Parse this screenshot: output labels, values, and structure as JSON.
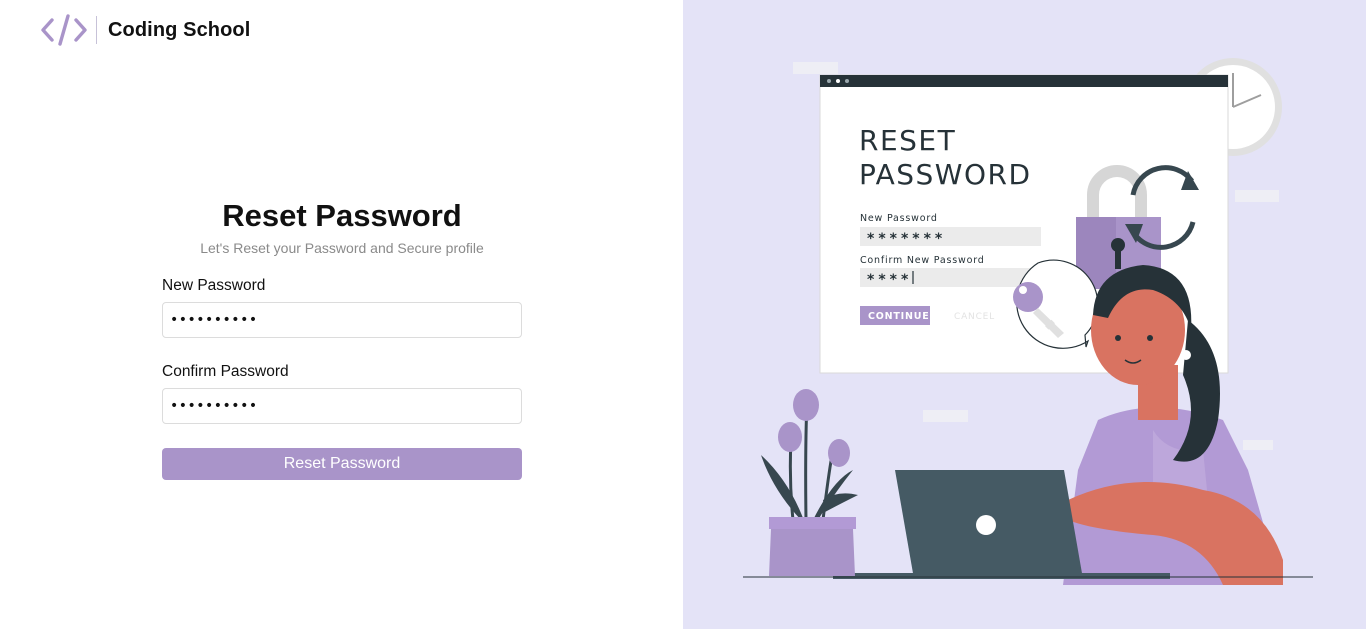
{
  "brand": {
    "name": "Coding School",
    "logo_icon": "code-brackets-icon",
    "accent_color": "#a994c9"
  },
  "form": {
    "title": "Reset Password",
    "subtitle": "Let's Reset your Password and Secure profile",
    "new_password_label": "New Password",
    "new_password_value": "Reset12345",
    "confirm_password_label": "Confirm Password",
    "confirm_password_value": "Reset12345",
    "submit_label": "Reset Password"
  },
  "illustration": {
    "title_line1": "RESET",
    "title_line2": "PASSWORD",
    "new_password_label": "New Password",
    "new_password_mask": "*******",
    "confirm_label": "Confirm New Password",
    "confirm_mask": "****",
    "continue_label": "CONTINUE",
    "cancel_label": "CANCEL",
    "background_color": "#e4e3f7"
  }
}
